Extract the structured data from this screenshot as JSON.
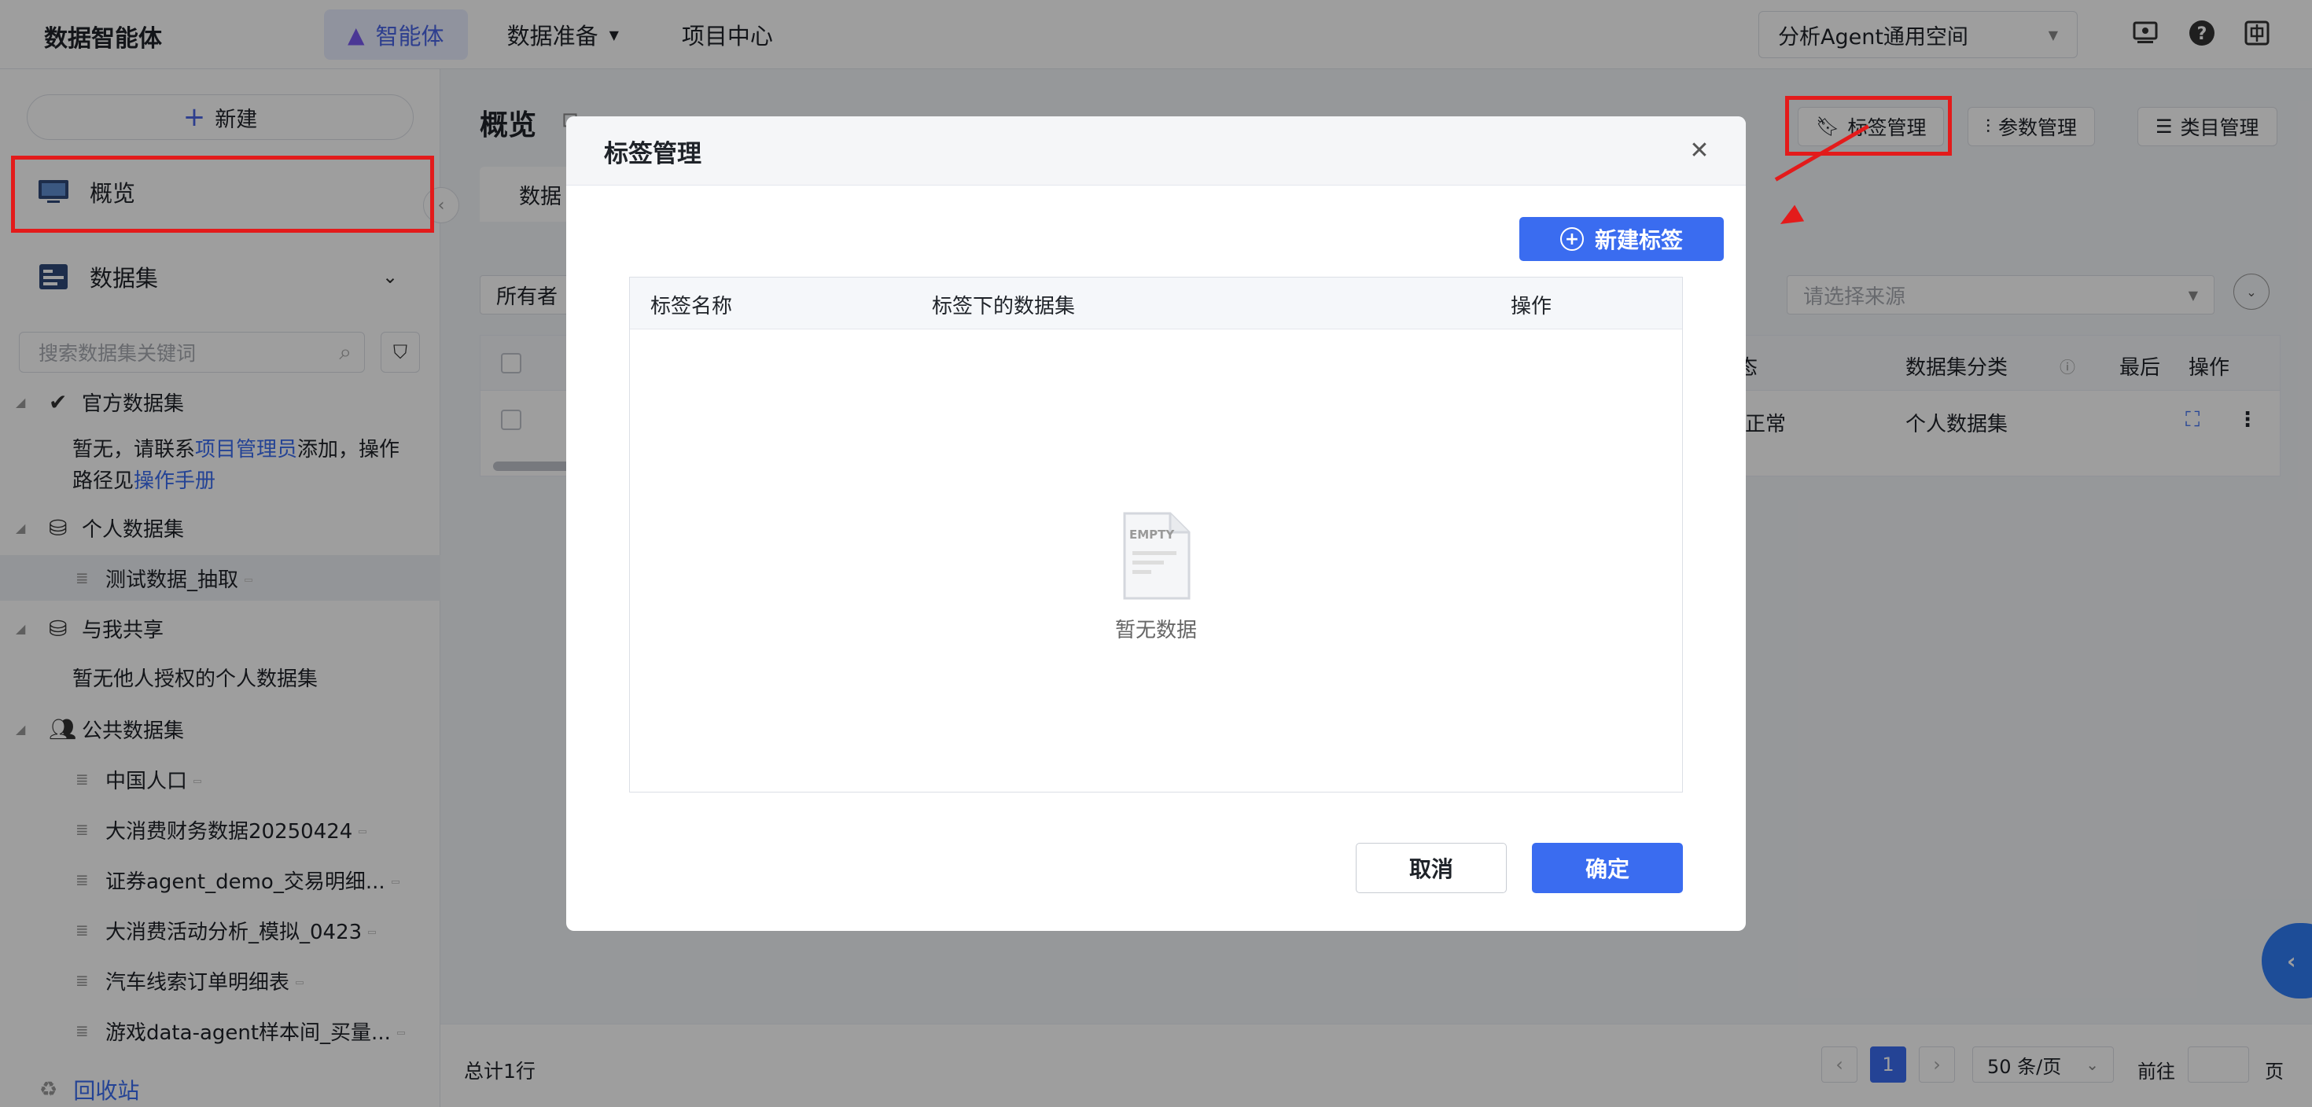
{
  "app": {
    "title": "数据智能体"
  },
  "topnav": {
    "agent": "智能体",
    "data_prep": "数据准备",
    "project_center": "项目中心",
    "workspace": "分析Agent通用空间"
  },
  "sidebar": {
    "new_button": "新建",
    "overview": "概览",
    "datasets": "数据集",
    "search_placeholder": "搜索数据集关键词",
    "official_group": "官方数据集",
    "official_note_1": "暂无，请联系",
    "official_note_link1": "项目管理员",
    "official_note_2": "添加，操作",
    "official_note_3": "路径见",
    "official_note_link2": "操作手册",
    "personal_group": "个人数据集",
    "personal_items": [
      "测试数据_抽取"
    ],
    "shared_group": "与我共享",
    "shared_note": "暂无他人授权的个人数据集",
    "public_group": "公共数据集",
    "public_items": [
      "中国人口",
      "大消费财务数据20250424",
      "证券agent_demo_交易明细...",
      "大消费活动分析_模拟_0423",
      "汽车线索订单明细表",
      "游戏data-agent样本间_买量..."
    ],
    "recycle": "回收站"
  },
  "main": {
    "title": "概览",
    "tag_manage": "标签管理",
    "param_manage": "参数管理",
    "category_manage": "类目管理",
    "tab_label": "数据",
    "owner_filter": "所有者",
    "source_placeholder": "请选择来源",
    "table": {
      "headers": {
        "status": "态",
        "category": "数据集分类",
        "last": "最后",
        "actions": "操作"
      },
      "row": {
        "status": "正常",
        "category": "个人数据集"
      }
    },
    "footer": {
      "total": "总计1行",
      "page": "1",
      "page_size": "50 条/页",
      "goto": "前往",
      "page_unit": "页"
    }
  },
  "modal": {
    "title": "标签管理",
    "new_tag": "新建标签",
    "columns": [
      "标签名称",
      "标签下的数据集",
      "操作"
    ],
    "empty_icon_text": "EMPTY",
    "empty_text": "暂无数据",
    "cancel": "取消",
    "confirm": "确定"
  },
  "colors": {
    "primary": "#3a6cf0",
    "annotation_red": "#e31b1b"
  }
}
